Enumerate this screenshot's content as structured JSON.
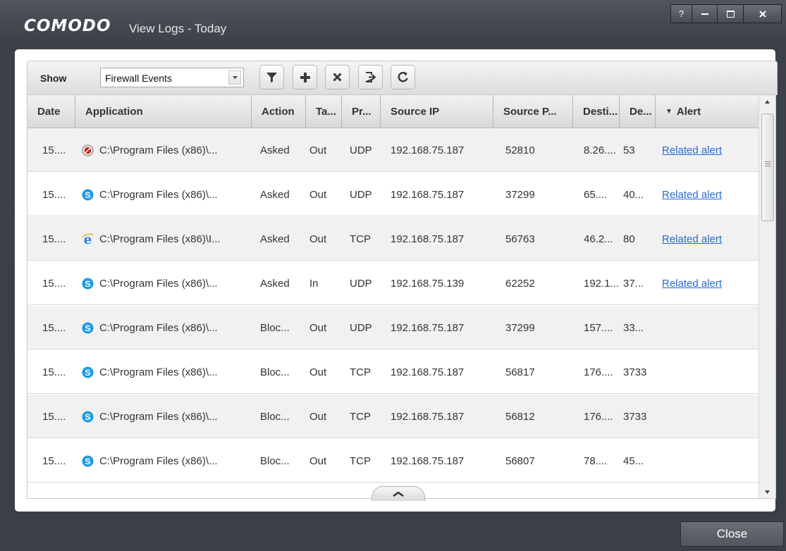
{
  "window": {
    "logo": "COMODO",
    "title": "View Logs - Today",
    "controls": {
      "help": "?"
    }
  },
  "toolbar": {
    "show_label": "Show",
    "show_value": "Firewall Events",
    "buttons": [
      "filter-icon",
      "add-icon",
      "delete-icon",
      "export-icon",
      "refresh-icon"
    ]
  },
  "table": {
    "columns": [
      "Date",
      "Application",
      "Action",
      "Ta...",
      "Pr...",
      "Source IP",
      "Source P...",
      "Desti...",
      "De...",
      "Alert"
    ],
    "sort_column": "Alert",
    "rows": [
      {
        "date": "15....",
        "icon": "red-app-icon",
        "app": "C:\\Program Files (x86)\\...",
        "action": "Asked",
        "target": "Out",
        "protocol": "UDP",
        "source_ip": "192.168.75.187",
        "source_port": "52810",
        "dest": "8.26....",
        "dest_port": "53",
        "alert": "Related alert"
      },
      {
        "date": "15....",
        "icon": "skype-icon",
        "app": "C:\\Program Files (x86)\\...",
        "action": "Asked",
        "target": "Out",
        "protocol": "UDP",
        "source_ip": "192.168.75.187",
        "source_port": "37299",
        "dest": "65....",
        "dest_port": "40...",
        "alert": "Related alert"
      },
      {
        "date": "15....",
        "icon": "ie-icon",
        "app": "C:\\Program Files (x86)\\I...",
        "action": "Asked",
        "target": "Out",
        "protocol": "TCP",
        "source_ip": "192.168.75.187",
        "source_port": "56763",
        "dest": "46.2...",
        "dest_port": "80",
        "alert": "Related alert"
      },
      {
        "date": "15....",
        "icon": "skype-icon",
        "app": "C:\\Program Files (x86)\\...",
        "action": "Asked",
        "target": "In",
        "protocol": "UDP",
        "source_ip": "192.168.75.139",
        "source_port": "62252",
        "dest": "192.1...",
        "dest_port": "37...",
        "alert": "Related alert"
      },
      {
        "date": "15....",
        "icon": "skype-icon",
        "app": "C:\\Program Files (x86)\\...",
        "action": "Bloc...",
        "target": "Out",
        "protocol": "UDP",
        "source_ip": "192.168.75.187",
        "source_port": "37299",
        "dest": "157....",
        "dest_port": "33...",
        "alert": ""
      },
      {
        "date": "15....",
        "icon": "skype-icon",
        "app": "C:\\Program Files (x86)\\...",
        "action": "Bloc...",
        "target": "Out",
        "protocol": "TCP",
        "source_ip": "192.168.75.187",
        "source_port": "56817",
        "dest": "176....",
        "dest_port": "3733",
        "alert": ""
      },
      {
        "date": "15....",
        "icon": "skype-icon",
        "app": "C:\\Program Files (x86)\\...",
        "action": "Bloc...",
        "target": "Out",
        "protocol": "TCP",
        "source_ip": "192.168.75.187",
        "source_port": "56812",
        "dest": "176....",
        "dest_port": "3733",
        "alert": ""
      },
      {
        "date": "15....",
        "icon": "skype-icon",
        "app": "C:\\Program Files (x86)\\...",
        "action": "Bloc...",
        "target": "Out",
        "protocol": "TCP",
        "source_ip": "192.168.75.187",
        "source_port": "56807",
        "dest": "78....",
        "dest_port": "45...",
        "alert": ""
      }
    ]
  },
  "footer": {
    "close_label": "Close"
  },
  "colors": {
    "link": "#2a6bc9",
    "window_bg": "#3f434a",
    "skype": "#1e9be3",
    "ie": "#2a7fd4"
  }
}
